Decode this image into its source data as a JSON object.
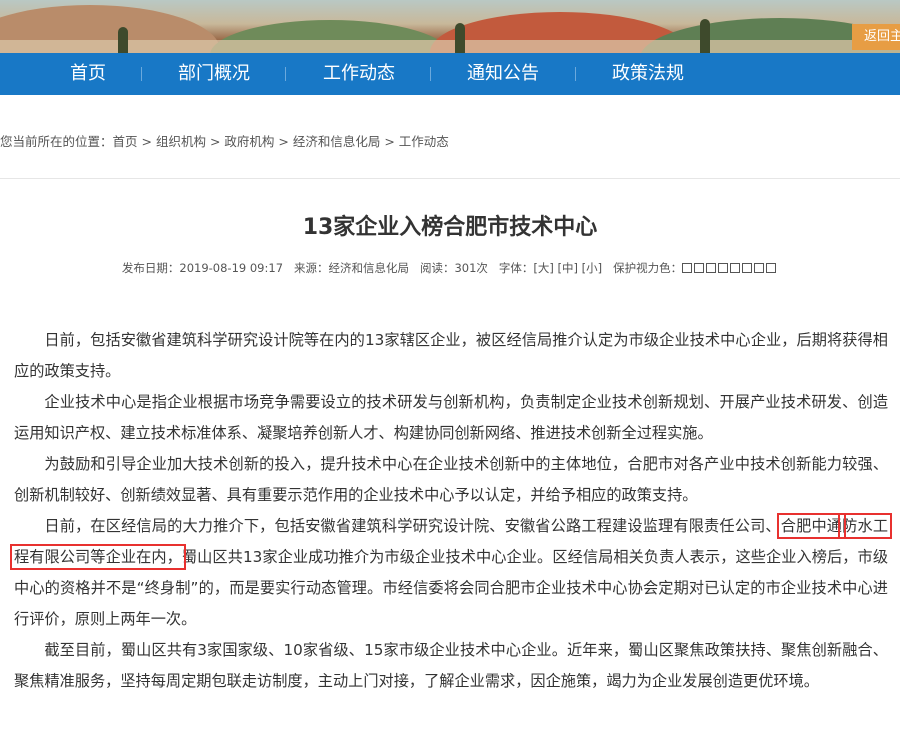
{
  "header": {
    "back_home_label": "返回主"
  },
  "nav": {
    "items": [
      "首页",
      "部门概况",
      "工作动态",
      "通知公告",
      "政策法规"
    ]
  },
  "breadcrumb": {
    "prefix": "您当前所在的位置：",
    "items": [
      "首页",
      "组织机构",
      "政府机构",
      "经济和信息化局",
      "工作动态"
    ],
    "separator": " > "
  },
  "article": {
    "title": "13家企业入榜合肥市技术中心",
    "meta": {
      "date_label": "发布日期：",
      "date": "2019-08-19 09:17",
      "source_label": "来源：",
      "source": "经济和信息化局",
      "views_label": "阅读：",
      "views": "301次",
      "font_label": "字体：",
      "font_large": "[大]",
      "font_medium": "[中]",
      "font_small": "[小]",
      "eye_label": "保护视力色："
    },
    "paragraphs": [
      {
        "text": "日前，包括安徽省建筑科学研究设计院等在内的13家辖区企业，被区经信局推介认定为市级企业技术中心企业，后期将获得相应的政策支持。"
      },
      {
        "text": "企业技术中心是指企业根据市场竞争需要设立的技术研发与创新机构，负责制定企业技术创新规划、开展产业技术研发、创造运用知识产权、建立技术标准体系、凝聚培养创新人才、构建协同创新网络、推进技术创新全过程实施。"
      },
      {
        "text": "为鼓励和引导企业加大技术创新的投入，提升技术中心在企业技术创新中的主体地位，合肥市对各产业中技术创新能力较强、创新机制较好、创新绩效显著、具有重要示范作用的企业技术中心予以认定，并给予相应的政策支持。"
      },
      {
        "before": "日前，在区经信局的大力推介下，包括安徽省建筑科学研究设计院、安徽省公路工程建设监理有限责任公司、",
        "hl1": "合肥中通",
        "hl2": "防水工程有限公司等企业在内，",
        "after": "蜀山区共13家企业成功推介为市级企业技术中心企业。区经信局相关负责人表示，这些企业入榜后，市级中心的资格并不是“终身制”的，而是要实行动态管理。市经信委将会同合肥市企业技术中心协会定期对已认定的市企业技术中心进行评价，原则上两年一次。"
      },
      {
        "text": "截至目前，蜀山区共有3家国家级、10家省级、15家市级企业技术中心企业。近年来，蜀山区聚焦政策扶持、聚焦创新融合、聚焦精准服务，坚持每周定期包联走访制度，主动上门对接，了解企业需求，因企施策，竭力为企业发展创造更优环境。"
      }
    ]
  }
}
